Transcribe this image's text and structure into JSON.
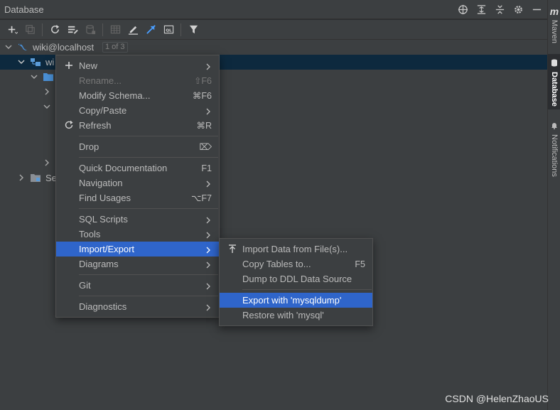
{
  "panel": {
    "title": "Database",
    "actions": [
      "crosshair-icon",
      "expand-all-icon",
      "collapse-all-icon",
      "gear-icon",
      "minimize-icon"
    ]
  },
  "toolbar": {
    "buttons": [
      "add-icon",
      "duplicate-icon",
      "refresh-icon",
      "schema-properties-icon",
      "disconnect-icon",
      "table-icon",
      "edit-icon",
      "jump-to-source-icon",
      "query-console-icon",
      "filter-icon"
    ]
  },
  "tree": {
    "connection": {
      "name": "wiki@localhost",
      "badge": "1 of 3"
    },
    "selected_node": "wi",
    "server_objects": "Se"
  },
  "context_menu": {
    "items": [
      {
        "label": "New",
        "icon": "plus-icon",
        "submenu": true
      },
      {
        "label": "Rename...",
        "shortcut": "⇧F6",
        "disabled": true
      },
      {
        "label": "Modify Schema...",
        "shortcut": "⌘F6"
      },
      {
        "label": "Copy/Paste",
        "submenu": true
      },
      {
        "label": "Refresh",
        "icon": "refresh-icon",
        "shortcut": "⌘R"
      },
      {
        "label": "Drop",
        "shortcut": "⌦"
      },
      {
        "label": "Quick Documentation",
        "shortcut": "F1"
      },
      {
        "label": "Navigation",
        "submenu": true
      },
      {
        "label": "Find Usages",
        "shortcut": "⌥F7"
      },
      {
        "label": "SQL Scripts",
        "submenu": true
      },
      {
        "label": "Tools",
        "submenu": true
      },
      {
        "label": "Import/Export",
        "submenu": true,
        "highlighted": true
      },
      {
        "label": "Diagrams",
        "submenu": true
      },
      {
        "label": "Git",
        "submenu": true
      },
      {
        "label": "Diagnostics",
        "submenu": true
      }
    ]
  },
  "submenu": {
    "items": [
      {
        "label": "Import Data from File(s)...",
        "icon": "import-icon"
      },
      {
        "label": "Copy Tables to...",
        "shortcut": "F5"
      },
      {
        "label": "Dump to DDL Data Source"
      },
      {
        "label": "Export with 'mysqldump'",
        "highlighted": true
      },
      {
        "label": "Restore with 'mysql'"
      }
    ]
  },
  "right_sidebar": {
    "maven_logo": "m",
    "tabs": [
      {
        "label": "Maven"
      },
      {
        "label": "Database",
        "active": true
      },
      {
        "label": "Notifications"
      }
    ]
  },
  "watermark": "CSDN @HelenZhaoUS",
  "colors": {
    "background": "#2b2d30",
    "panel": "#3c3f41",
    "selection": "#2f65ca",
    "tree_selection": "#0d293e",
    "text": "#bbbbbb"
  }
}
